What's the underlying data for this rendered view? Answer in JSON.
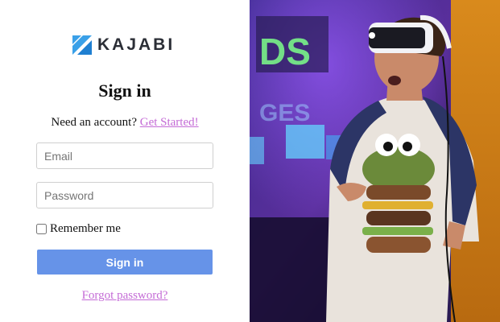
{
  "brand": {
    "name": "KAJABI",
    "color": "#2b2e36",
    "mark_color": "#3aa0e8"
  },
  "signin": {
    "title": "Sign in",
    "prompt": "Need an account?",
    "get_started": "Get Started!",
    "email_placeholder": "Email",
    "password_placeholder": "Password",
    "remember_label": "Remember me",
    "remember_checked": false,
    "button_label": "Sign in",
    "forgot_link": "Forgot password?"
  },
  "colors": {
    "link": "#c46bd6",
    "button": "#6693e8"
  },
  "hero_image": {
    "subject": "person wearing VR headset and burger-print t-shirt"
  }
}
